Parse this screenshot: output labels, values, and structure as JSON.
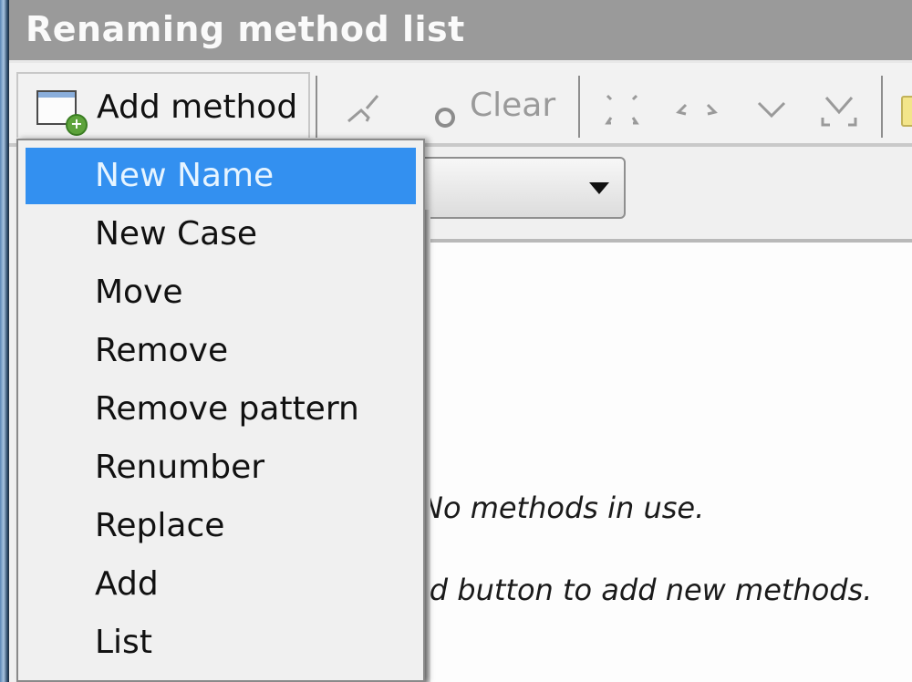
{
  "window": {
    "title": "Renaming method list"
  },
  "toolbar": {
    "add_method_label": "Add method",
    "clear_label": "Clear",
    "icons": [
      "add-method-icon",
      "edit-icon",
      "clear-icon",
      "expand-icon",
      "collapse-icon",
      "move-down-icon",
      "move-to-bottom-icon",
      "folder-icon"
    ]
  },
  "menu": {
    "items": [
      {
        "label": "New Name",
        "selected": true
      },
      {
        "label": "New Case",
        "selected": false
      },
      {
        "label": "Move",
        "selected": false
      },
      {
        "label": "Remove",
        "selected": false
      },
      {
        "label": "Remove pattern",
        "selected": false
      },
      {
        "label": "Renumber",
        "selected": false
      },
      {
        "label": "Replace",
        "selected": false
      },
      {
        "label": "Add",
        "selected": false
      },
      {
        "label": "List",
        "selected": false
      }
    ]
  },
  "content": {
    "empty_message": "No methods in use.",
    "hint_message": "'d button to add new methods."
  },
  "colors": {
    "selection": "#3390f0",
    "titlebar": "#9a9a9a"
  }
}
